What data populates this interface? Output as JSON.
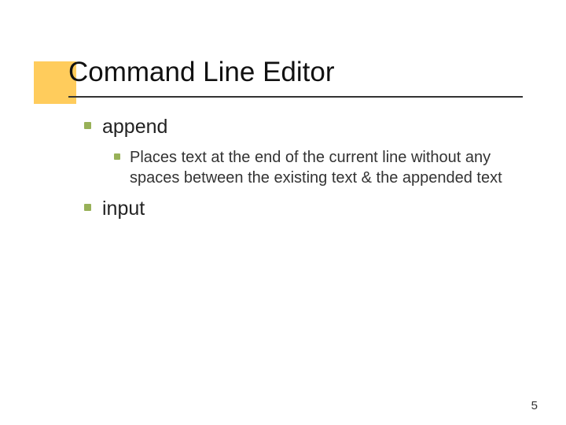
{
  "slide": {
    "title": "Command Line Editor",
    "page_number": "5"
  },
  "items": {
    "append": {
      "label": "append",
      "desc": "Places text at the end of the current line without any spaces between the existing text & the appended text"
    },
    "input": {
      "label": "input"
    }
  }
}
